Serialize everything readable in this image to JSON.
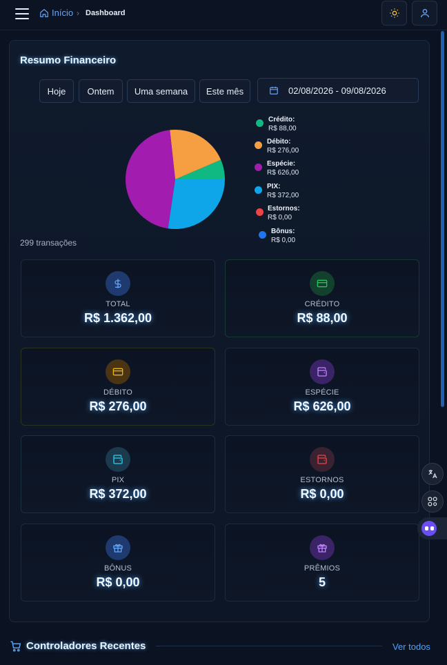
{
  "header": {
    "breadcrumb_home": "Início",
    "breadcrumb_current": "Dashboard"
  },
  "summary": {
    "title": "Resumo Financeiro",
    "filters": [
      "Hoje",
      "Ontem",
      "Uma semana",
      "Este mês"
    ],
    "date_range": "02/08/2026 - 09/08/2026",
    "transactions": "299 transações"
  },
  "chart_data": {
    "type": "pie",
    "labels": [
      "Crédito",
      "Débito",
      "Espécie",
      "PIX",
      "Estornos",
      "Bônus"
    ],
    "values": [
      88.0,
      276.0,
      626.0,
      372.0,
      0.0,
      0.0
    ],
    "colors": [
      "#10b981",
      "#f59e42",
      "#a21caf",
      "#0ea5e9",
      "#ef4444",
      "#1d75f0"
    ],
    "legend_labels": [
      "Crédito:",
      "Débito:",
      "Espécie:",
      "PIX:",
      "Estornos:",
      "Bônus:"
    ],
    "legend_values": [
      "R$ 88,00",
      "R$ 276,00",
      "R$ 626,00",
      "R$ 372,00",
      "R$ 0,00",
      "R$ 0,00"
    ],
    "legend_position": "right"
  },
  "stats": [
    {
      "label": "TOTAL",
      "value": "R$ 1.362,00",
      "icon": "dollar-icon",
      "color": "#60a5fa"
    },
    {
      "label": "CRÉDITO",
      "value": "R$ 88,00",
      "icon": "credit-card-icon",
      "color": "#22c55e"
    },
    {
      "label": "DÉBITO",
      "value": "R$ 276,00",
      "icon": "debit-card-icon",
      "color": "#eab308"
    },
    {
      "label": "ESPÉCIE",
      "value": "R$ 626,00",
      "icon": "wallet-icon",
      "color": "#c084fc"
    },
    {
      "label": "PIX",
      "value": "R$ 372,00",
      "icon": "wallet-icon",
      "color": "#22d3ee"
    },
    {
      "label": "ESTORNOS",
      "value": "R$ 0,00",
      "icon": "wallet-icon",
      "color": "#ef4444"
    },
    {
      "label": "BÔNUS",
      "value": "R$ 0,00",
      "icon": "gift-icon",
      "color": "#60a5fa"
    },
    {
      "label": "PRÊMIOS",
      "value": "5",
      "icon": "gift-icon",
      "color": "#c084fc"
    }
  ],
  "recent": {
    "title": "Controladores Recentes",
    "see_all": "Ver todos"
  }
}
